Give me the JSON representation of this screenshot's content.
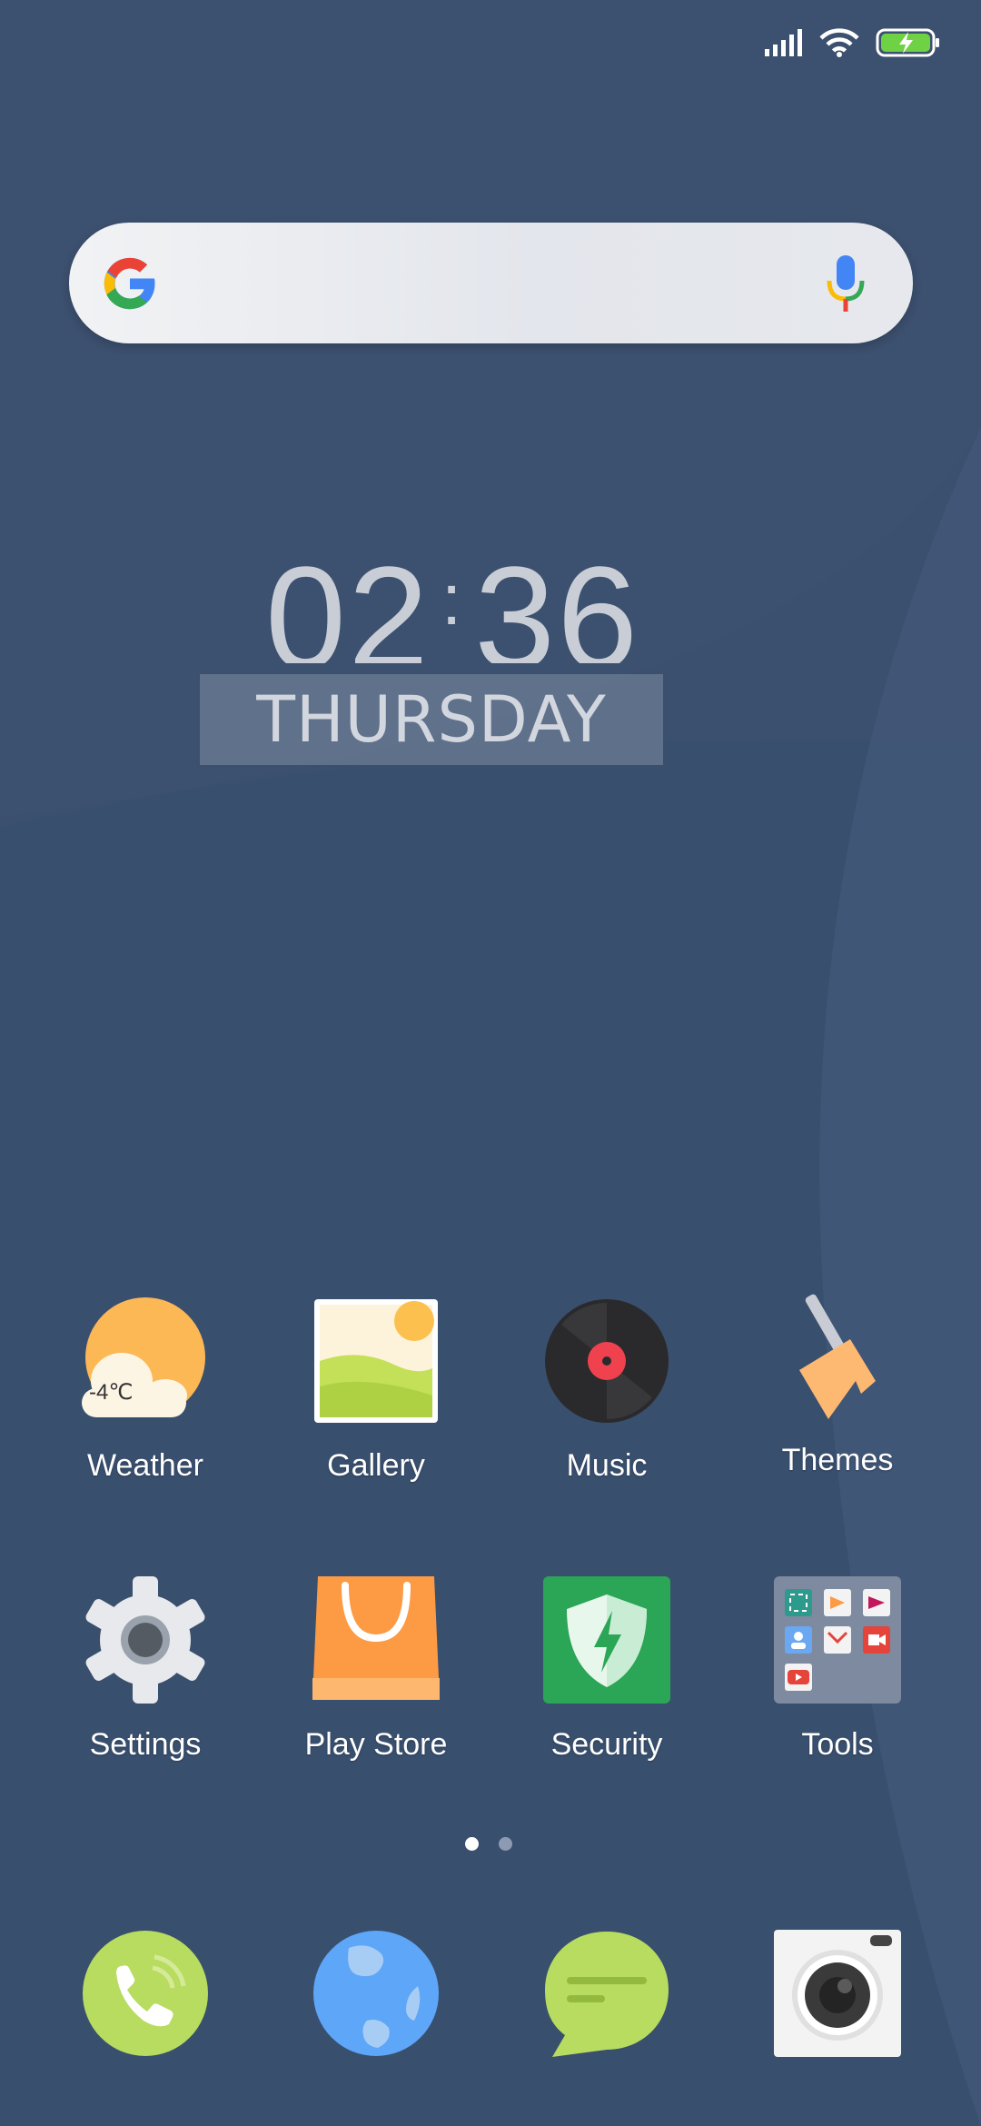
{
  "status_bar": {
    "signal_icon": "signal-icon",
    "wifi_icon": "wifi-icon",
    "battery_icon": "battery-charging-icon"
  },
  "search_bar": {
    "logo": "google-g-icon",
    "voice_icon": "mic-icon"
  },
  "clock": {
    "hours": "02",
    "separator": ":",
    "minutes": "36",
    "day": "THURSDAY"
  },
  "weather_widget": {
    "temperature": "-4℃"
  },
  "apps": [
    {
      "label": "Weather",
      "icon": "weather-icon"
    },
    {
      "label": "Gallery",
      "icon": "gallery-icon"
    },
    {
      "label": "Music",
      "icon": "music-icon"
    },
    {
      "label": "Themes",
      "icon": "themes-icon"
    },
    {
      "label": "Settings",
      "icon": "settings-icon"
    },
    {
      "label": "Play Store",
      "icon": "play-store-icon"
    },
    {
      "label": "Security",
      "icon": "security-icon"
    },
    {
      "label": "Tools",
      "icon": "tools-folder-icon"
    }
  ],
  "pages": {
    "count": 2,
    "current": 1
  },
  "dock": [
    {
      "icon": "phone-icon"
    },
    {
      "icon": "browser-icon"
    },
    {
      "icon": "messages-icon"
    },
    {
      "icon": "camera-icon"
    }
  ],
  "colors": {
    "wallpaper": "#3b4f6e",
    "accent_green": "#b9dc5f",
    "accent_blue": "#5da4f8"
  }
}
